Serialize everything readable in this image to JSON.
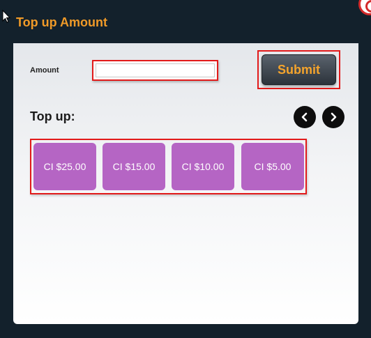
{
  "dialog": {
    "title": "Top up Amount",
    "title_color": "#f09a28"
  },
  "amount": {
    "label": "Amount",
    "value": "",
    "placeholder": ""
  },
  "submit": {
    "label": "Submit",
    "text_color": "#f5a42c"
  },
  "topup": {
    "heading": "Top up:",
    "prev_icon": "chevron-left-icon",
    "next_icon": "chevron-right-icon",
    "options": [
      {
        "label": "CI $25.00"
      },
      {
        "label": "CI $15.00"
      },
      {
        "label": "CI $10.00"
      },
      {
        "label": "CI $5.00"
      }
    ],
    "option_color": "#b565c4"
  },
  "highlight_color": "#e21a1a"
}
